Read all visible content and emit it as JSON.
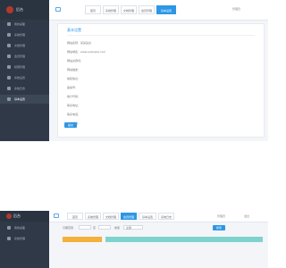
{
  "shot1": {
    "brand": "后台",
    "sidebar": [
      {
        "label": "我的桌面"
      },
      {
        "label": "系统管理"
      },
      {
        "label": "文档管理"
      },
      {
        "label": "会员管理"
      },
      {
        "label": "权限管理"
      },
      {
        "label": "系统设置"
      },
      {
        "label": "系统日志"
      },
      {
        "label": "基本设置"
      }
    ],
    "tabs": [
      {
        "label": "首页"
      },
      {
        "label": "系统管理"
      },
      {
        "label": "文档管理"
      },
      {
        "label": "会员管理"
      },
      {
        "label": "基本设置"
      }
    ],
    "topbar_right": "管理员",
    "panel": {
      "title": "基本设置",
      "rows": [
        "网站名称：某某后台",
        "网站域名：www.example.com",
        "网站关键词：",
        "网站描述：",
        "版权信息：",
        "备案号：",
        "统计代码：",
        "联系地址：",
        "联系电话：",
        "电子邮箱："
      ],
      "submit": "提交"
    }
  },
  "shot2": {
    "brand": "后台",
    "sidebar": [
      {
        "label": "我的桌面"
      },
      {
        "label": "系统管理"
      }
    ],
    "tabs": [
      {
        "label": "首页"
      },
      {
        "label": "系统管理"
      },
      {
        "label": "文档管理"
      },
      {
        "label": "会员管理"
      },
      {
        "label": "基本设置"
      },
      {
        "label": "系统日志"
      }
    ],
    "topbar_right": [
      "管理员",
      "退出"
    ],
    "filters": [
      "日期范围",
      "至",
      "类型",
      "全部"
    ],
    "search": "搜索"
  }
}
